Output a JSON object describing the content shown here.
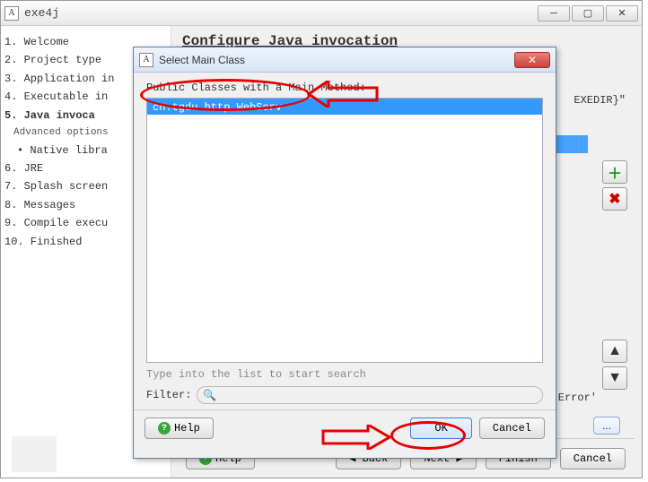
{
  "main_window": {
    "title": "exe4j",
    "heading": "Configure Java invocation",
    "steps": [
      "1. Welcome",
      "2. Project type",
      "3. Application in",
      "4. Executable in",
      "5. Java invoca",
      "Advanced options",
      "• Native libra",
      "6. JRE",
      "7. Splash screen",
      "8. Messages",
      "9. Compile execu",
      "10. Finished"
    ],
    "path_hint": "EXEDIR}\"",
    "fail_label": "'Fail on Error'",
    "dots_label": "...",
    "footer": {
      "help": "Help",
      "back": "◀  Back",
      "next": "Next  ▶",
      "finish": "Finish",
      "cancel": "Cancel"
    }
  },
  "dialog": {
    "title": "Select Main Class",
    "list_label": "Public Classes with a Main Method:",
    "items": [
      "cn.tgdu.http.WebServ"
    ],
    "type_hint": "Type into the list to start search",
    "filter_label": "Filter:",
    "filter_placeholder": "",
    "search_icon": "🔍",
    "footer": {
      "help": "Help",
      "ok": "OK",
      "cancel": "Cancel"
    }
  }
}
